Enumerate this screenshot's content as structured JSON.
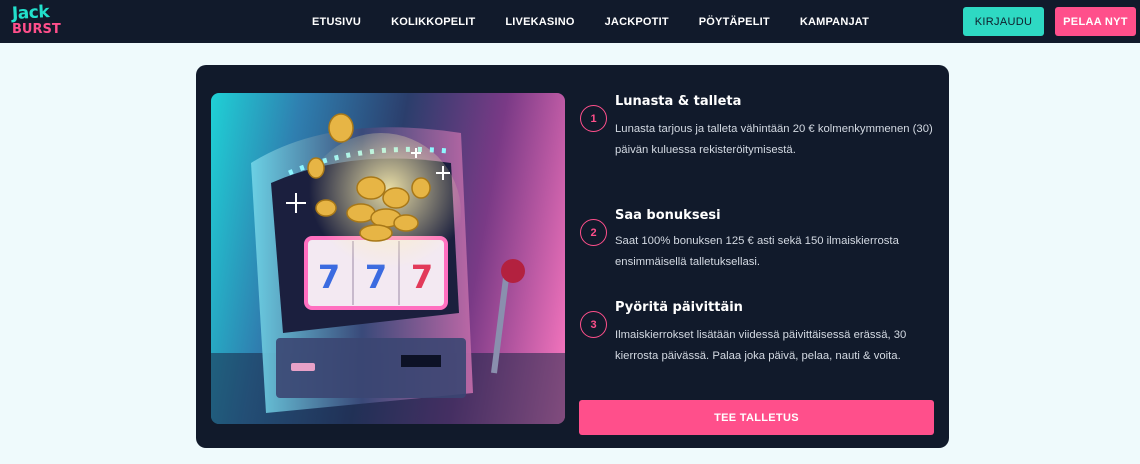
{
  "brand": {
    "logo_line1": "Jack",
    "logo_line2": "BURST"
  },
  "nav": {
    "items": [
      {
        "label": "ETUSIVU"
      },
      {
        "label": "KOLIKKOPELIT"
      },
      {
        "label": "LIVEKASINO"
      },
      {
        "label": "JACKPOTIT"
      },
      {
        "label": "PÖYTÄPELIT"
      },
      {
        "label": "KAMPANJAT"
      }
    ]
  },
  "header_buttons": {
    "login": "KIRJAUDU",
    "play": "PELAA NYT"
  },
  "colors": {
    "accent_teal": "#2ed9c3",
    "accent_pink": "#ff4f8b",
    "card_bg": "#111a2b",
    "page_bg": "#effafc"
  },
  "steps": [
    {
      "number": "1",
      "title": "Lunasta & talleta",
      "text": "Lunasta tarjous ja talleta vähintään 20 € kolmenkymmenen (30) päivän kuluessa rekisteröitymisestä."
    },
    {
      "number": "2",
      "title": "Saa bonuksesi",
      "text": "Saat 100% bonuksen 125 € asti sekä 150 ilmaiskierrosta ensimmäisellä talletuksellasi."
    },
    {
      "number": "3",
      "title": "Pyöritä päivittäin",
      "text": "Ilmaiskierrokset lisätään viidessä päivittäisessä erässä, 30 kierrosta päivässä. Palaa joka päivä, pelaa, nauti & voita."
    }
  ],
  "cta": {
    "label": "TEE TALLETUS"
  },
  "hero": {
    "reel_symbols": [
      "7",
      "7",
      "7"
    ]
  }
}
